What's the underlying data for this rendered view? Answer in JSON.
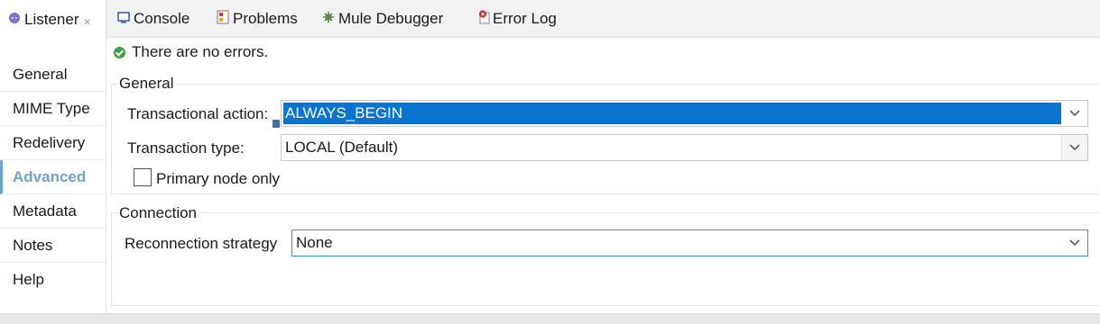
{
  "tabs": [
    {
      "label": "Listener",
      "icon": "listener-icon",
      "close": "×"
    },
    {
      "label": "Console",
      "icon": "console-icon"
    },
    {
      "label": "Problems",
      "icon": "problems-icon"
    },
    {
      "label": "Mule Debugger",
      "icon": "debugger-icon"
    },
    {
      "label": "Error Log",
      "icon": "error-log-icon"
    }
  ],
  "nav": {
    "items": [
      {
        "label": "General"
      },
      {
        "label": "MIME Type"
      },
      {
        "label": "Redelivery"
      },
      {
        "label": "Advanced"
      },
      {
        "label": "Metadata"
      },
      {
        "label": "Notes"
      },
      {
        "label": "Help"
      }
    ],
    "active": "Advanced"
  },
  "status": {
    "text": "There are no errors."
  },
  "general": {
    "title": "General",
    "transactional_action_label": "Transactional action:",
    "transactional_action_value": "ALWAYS_BEGIN",
    "transaction_type_label": "Transaction type:",
    "transaction_type_value": "LOCAL (Default)",
    "primary_node_label": "Primary node only",
    "primary_node_checked": false
  },
  "connection": {
    "title": "Connection",
    "reconnection_label": "Reconnection strategy",
    "reconnection_value": "None"
  },
  "colors": {
    "accent": "#6fa3c8",
    "selection": "#0a74d1",
    "ok": "#3ea34a"
  }
}
